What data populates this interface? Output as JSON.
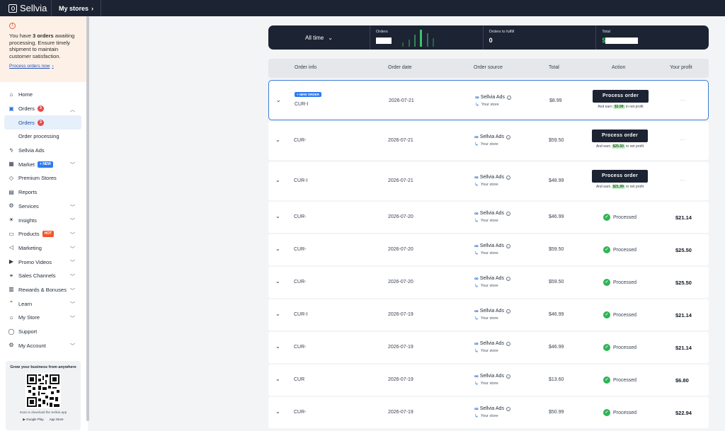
{
  "topbar": {
    "brand": "Sellvia",
    "my_stores": "My stores"
  },
  "alert": {
    "prefix": "You have ",
    "count_text": "3 orders",
    "suffix": " awaiting processing. Ensure timely shipment to maintain customer satisfaction.",
    "link": "Process orders now"
  },
  "nav": {
    "home": "Home",
    "orders": "Orders",
    "orders_badge": "3",
    "orders_sub": "Orders",
    "orders_sub_badge": "3",
    "order_processing": "Order processing",
    "sellvia_ads": "Sellvia Ads",
    "market": "Market",
    "market_badge": "+ NEW",
    "premium_stores": "Premium Stores",
    "reports": "Reports",
    "services": "Services",
    "insights": "Insights",
    "products": "Products",
    "products_badge": "HOT",
    "marketing": "Marketing",
    "promo_videos": "Promo Videos",
    "sales_channels": "Sales Channels",
    "rewards": "Rewards & Bonuses",
    "learn": "Learn",
    "my_store": "My Store",
    "support": "Support",
    "my_account": "My Account"
  },
  "promo": {
    "title": "Grow your business from anywhere",
    "subtitle": "Scan to download the Sellvia app",
    "google_play": "Google Play",
    "app_store": "App Store"
  },
  "stats": {
    "filter": "All time",
    "orders_label": "Orders",
    "to_fulfill_label": "Orders to fulfill",
    "to_fulfill_value": "0",
    "total_label": "Total",
    "total_currency": "$"
  },
  "table": {
    "headers": {
      "order_info": "Order info",
      "order_date": "Order date",
      "order_source": "Order source",
      "total": "Total",
      "action": "Action",
      "profit": "Your profit"
    },
    "process_label": "Process order",
    "earn_prefix": "And earn",
    "earn_suffix": "in net profit",
    "processed_label": "Processed",
    "source_name": "Sellvia Ads",
    "source_store": "Your store",
    "new_order_badge": "+ NEW ORDER",
    "no_profit": "---",
    "rows": [
      {
        "id": "CUR-I",
        "date": "2026-07-21",
        "total": "$8.99",
        "earn": "$3.99",
        "profit": ""
      },
      {
        "id": "CUR-",
        "date": "2026-07-21",
        "total": "$59.50",
        "earn": "$25.50",
        "profit": ""
      },
      {
        "id": "CUR-I",
        "date": "2026-07-21",
        "total": "$48.99",
        "earn": "$21.99",
        "profit": ""
      },
      {
        "id": "CUR-",
        "date": "2026-07-20",
        "total": "$46.99",
        "earn": "",
        "profit": "$21.14"
      },
      {
        "id": "CUR-",
        "date": "2026-07-20",
        "total": "$59.50",
        "earn": "",
        "profit": "$25.50"
      },
      {
        "id": "CUR-",
        "date": "2026-07-20",
        "total": "$59.50",
        "earn": "",
        "profit": "$25.50"
      },
      {
        "id": "CUR-I",
        "date": "2026-07-19",
        "total": "$46.99",
        "earn": "",
        "profit": "$21.14"
      },
      {
        "id": "CUR-",
        "date": "2026-07-19",
        "total": "$46.99",
        "earn": "",
        "profit": "$21.14"
      },
      {
        "id": "CUR",
        "date": "2026-07-19",
        "total": "$13.60",
        "earn": "",
        "profit": "$6.80"
      },
      {
        "id": "CUR-",
        "date": "2026-07-19",
        "total": "$50.99",
        "earn": "",
        "profit": "$22.94"
      }
    ]
  }
}
